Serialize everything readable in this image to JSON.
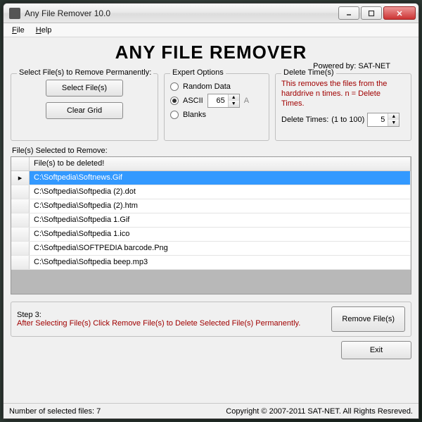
{
  "window": {
    "title": "Any File Remover 10.0"
  },
  "menubar": {
    "file": "File",
    "help": "Help"
  },
  "header": {
    "app_title": "ANY FILE REMOVER",
    "powered": "Powered by: SAT-NET"
  },
  "select": {
    "legend": "Select File(s) to Remove Permanently:",
    "select_btn": "Select File(s)",
    "clear_btn": "Clear Grid"
  },
  "expert": {
    "legend": "Expert Options",
    "random": "Random Data",
    "ascii": "ASCII",
    "ascii_value": "65",
    "ascii_suffix": "A",
    "blanks": "Blanks",
    "selected": "ascii"
  },
  "delete": {
    "legend": "Delete Time(s)",
    "desc": "This removes the files from the harddrive n times. n = Delete Times.",
    "label": "Delete Times:",
    "range": "(1 to 100)",
    "value": "5"
  },
  "grid": {
    "label": "File(s) Selected to Remove:",
    "header": "File(s) to be deleted!",
    "rows": [
      "C:\\Softpedia\\Softnews.Gif",
      "C:\\Softpedia\\Softpedia (2).dot",
      "C:\\Softpedia\\Softpedia (2).htm",
      "C:\\Softpedia\\Softpedia 1.Gif",
      "C:\\Softpedia\\Softpedia 1.ico",
      "C:\\Softpedia\\SOFTPEDIA barcode.Png",
      "C:\\Softpedia\\Softpedia beep.mp3"
    ],
    "selected_index": 0
  },
  "step3": {
    "title": "Step 3:",
    "msg": "After Selecting File(s) Click Remove File(s) to Delete Selected File(s) Permanently.",
    "remove_btn": "Remove File(s)"
  },
  "exit_btn": "Exit",
  "status": {
    "left": "Number of selected files:  7",
    "right": "Copyright © 2007-2011 SAT-NET. All Rights Resreved."
  }
}
